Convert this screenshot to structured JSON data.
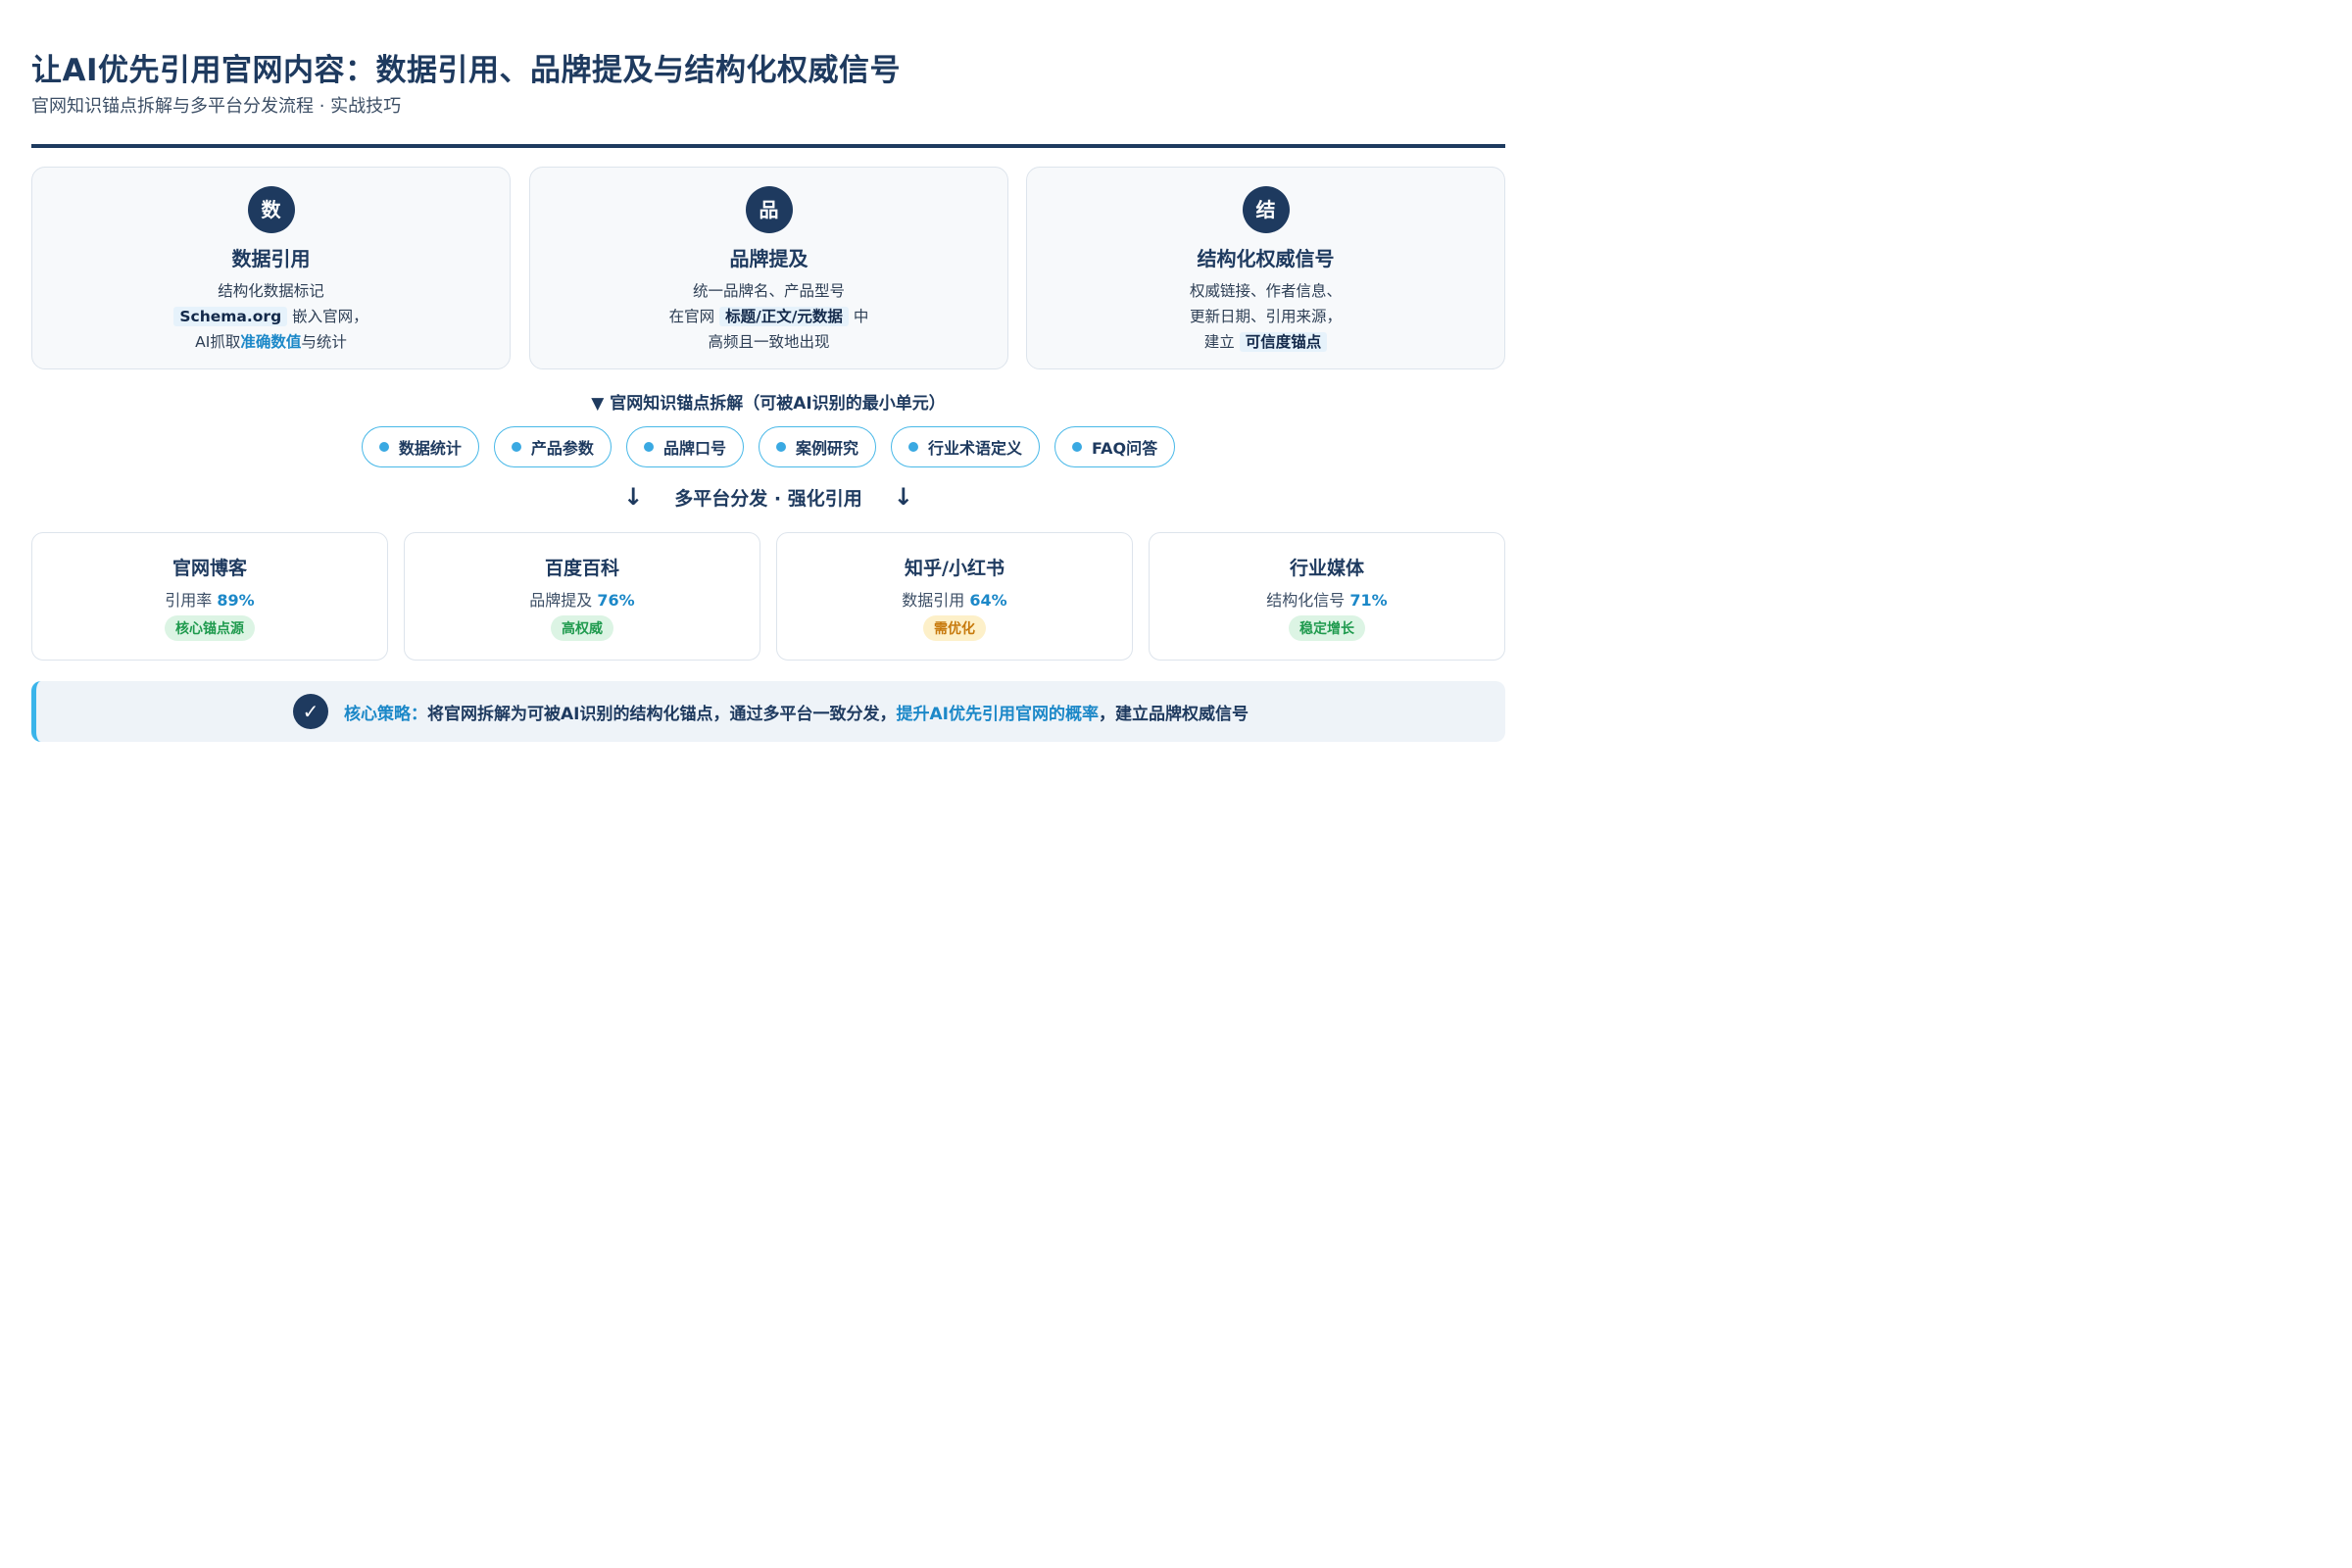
{
  "header": {
    "title": "让AI优先引用官网内容：数据引用、品牌提及与结构化权威信号",
    "subtitle": "官网知识锚点拆解与多平台分发流程 · 实战技巧"
  },
  "pillars": [
    {
      "badge": "数",
      "title": "数据引用",
      "line1": "结构化数据标记",
      "line2_highlight": "Schema.org",
      "line2_rest": " 嵌入官网，",
      "line3_pre": "AI抓取",
      "line3_link": "准确数值",
      "line3_post": "与统计"
    },
    {
      "badge": "品",
      "title": "品牌提及",
      "line1": "统一品牌名、产品型号",
      "line2_pre": "在官网 ",
      "line2_highlight": "标题/正文/元数据",
      "line2_post": " 中",
      "line3": "高频且一致地出现"
    },
    {
      "badge": "结",
      "title": "结构化权威信号",
      "line1": "权威链接、作者信息、",
      "line2": "更新日期、引用来源，",
      "line3_pre": "建立 ",
      "line3_highlight": "可信度锚点"
    }
  ],
  "anchors": {
    "heading": "▼ 官网知识锚点拆解（可被AI识别的最小单元）",
    "items": [
      "数据统计",
      "产品参数",
      "品牌口号",
      "案例研究",
      "行业术语定义",
      "FAQ问答"
    ]
  },
  "distribution": {
    "label": "多平台分发 · 强化引用",
    "arrow": "↓"
  },
  "platforms": [
    {
      "name": "官网博客",
      "metric_label": "引用率",
      "metric_value": "89%",
      "tag": "核心锚点源",
      "tag_color": "green"
    },
    {
      "name": "百度百科",
      "metric_label": "品牌提及",
      "metric_value": "76%",
      "tag": "高权威",
      "tag_color": "green"
    },
    {
      "name": "知乎/小红书",
      "metric_label": "数据引用",
      "metric_value": "64%",
      "tag": "需优化",
      "tag_color": "orange"
    },
    {
      "name": "行业媒体",
      "metric_label": "结构化信号",
      "metric_value": "71%",
      "tag": "稳定增长",
      "tag_color": "green"
    }
  ],
  "strategy": {
    "icon": "✓",
    "label": "核心策略：",
    "text_a": "将官网拆解为可被AI识别的结构化锚点，通过多平台一致分发，",
    "link": "提升AI优先引用官网的概率",
    "text_b": "，建立品牌权威信号"
  },
  "colors": {
    "navy": "#1e3a5f",
    "accent_blue": "#1c88c8",
    "pill_border": "#48b8e8",
    "tag_green": "#1f9a4e",
    "tag_orange": "#c77a0d"
  }
}
